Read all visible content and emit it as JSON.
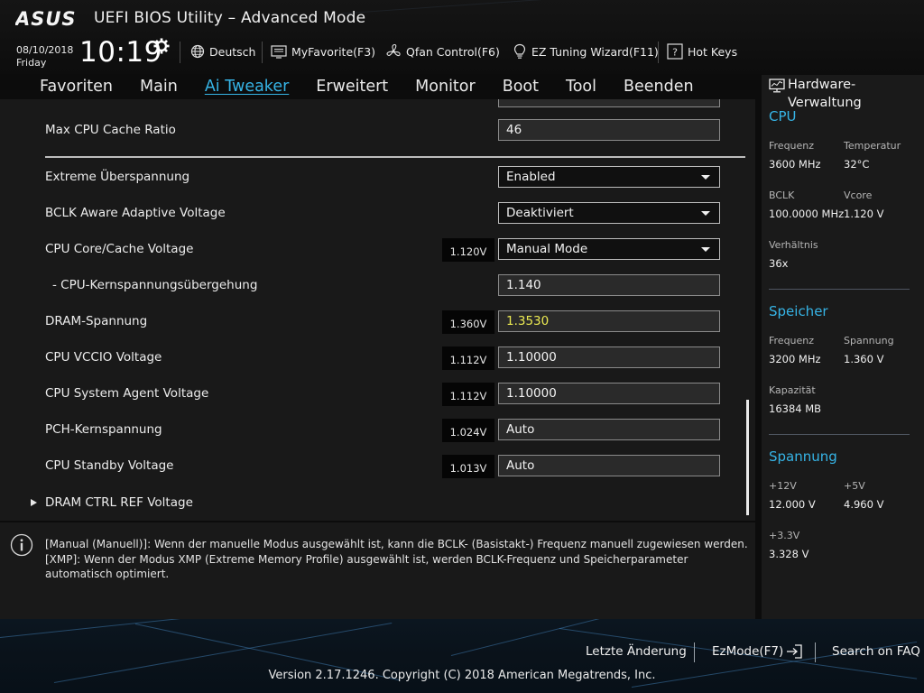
{
  "header": {
    "brand": "ASUS",
    "title": "UEFI BIOS Utility – Advanced Mode",
    "date": "08/10/2018",
    "day": "Friday",
    "time": "10:19",
    "toolbar": {
      "language": "Deutsch",
      "myfavorite": "MyFavorite(F3)",
      "qfan": "Qfan Control(F6)",
      "ez_tuning": "EZ Tuning Wizard(F11)",
      "hotkeys": "Hot Keys"
    }
  },
  "menu": {
    "tabs": [
      {
        "label": "Favoriten"
      },
      {
        "label": "Main"
      },
      {
        "label": "Ai Tweaker"
      },
      {
        "label": "Erweitert"
      },
      {
        "label": "Monitor"
      },
      {
        "label": "Boot"
      },
      {
        "label": "Tool"
      },
      {
        "label": "Beenden"
      }
    ],
    "active_tab": "Ai Tweaker"
  },
  "settings": {
    "max_cpu_cache_ratio": {
      "label": "Max CPU Cache Ratio",
      "value": "46"
    },
    "extreme_overvoltage": {
      "label": "Extreme Überspannung",
      "value": "Enabled"
    },
    "bclk_aware": {
      "label": "BCLK Aware Adaptive Voltage",
      "value": "Deaktiviert"
    },
    "cpu_core_cache_voltage": {
      "label": "CPU Core/Cache Voltage",
      "reading": "1.120V",
      "value": "Manual Mode"
    },
    "cpu_core_override": {
      "label": "- CPU-Kernspannungsübergehung",
      "value": "1.140"
    },
    "dram_voltage": {
      "label": "DRAM-Spannung",
      "reading": "1.360V",
      "value": "1.3530"
    },
    "cpu_vccio": {
      "label": "CPU VCCIO Voltage",
      "reading": "1.112V",
      "value": "1.10000"
    },
    "cpu_system_agent": {
      "label": "CPU System Agent Voltage",
      "reading": "1.112V",
      "value": "1.10000"
    },
    "pch_core": {
      "label": "PCH-Kernspannung",
      "reading": "1.024V",
      "value": "Auto"
    },
    "cpu_standby": {
      "label": "CPU Standby Voltage",
      "reading": "1.013V",
      "value": "Auto"
    },
    "dram_ctrl_ref": {
      "label": "DRAM CTRL REF Voltage"
    }
  },
  "info": {
    "line1": "[Manual (Manuell)]: Wenn der manuelle Modus ausgewählt ist, kann die BCLK- (Basistakt-) Frequenz manuell zugewiesen werden.",
    "line2": "[XMP]: Wenn der Modus XMP (Extreme Memory Profile) ausgewählt ist, werden BCLK-Frequenz und Speicherparameter automatisch optimiert."
  },
  "hardware_monitor": {
    "title": "Hardware-Verwaltung",
    "cpu": {
      "heading": "CPU",
      "freq_label": "Frequenz",
      "freq": "3600 MHz",
      "temp_label": "Temperatur",
      "temp": "32°C",
      "bclk_label": "BCLK",
      "bclk": "100.0000 MHz",
      "vcore_label": "Vcore",
      "vcore": "1.120 V",
      "ratio_label": "Verhältnis",
      "ratio": "36x"
    },
    "memory": {
      "heading": "Speicher",
      "freq_label": "Frequenz",
      "freq": "3200 MHz",
      "volt_label": "Spannung",
      "volt": "1.360 V",
      "cap_label": "Kapazität",
      "cap": "16384 MB"
    },
    "voltage": {
      "heading": "Spannung",
      "v12_label": "+12V",
      "v12": "12.000 V",
      "v5_label": "+5V",
      "v5": "4.960 V",
      "v33_label": "+3.3V",
      "v33": "3.328 V"
    }
  },
  "footer": {
    "last_change": "Letzte Änderung",
    "ezmode": "EzMode(F7)",
    "faq": "Search on FAQ",
    "copyright": "Version 2.17.1246. Copyright (C) 2018 American Megatrends, Inc."
  },
  "colors": {
    "accent": "#36b4e6",
    "highlight_value": "#ecea52"
  }
}
